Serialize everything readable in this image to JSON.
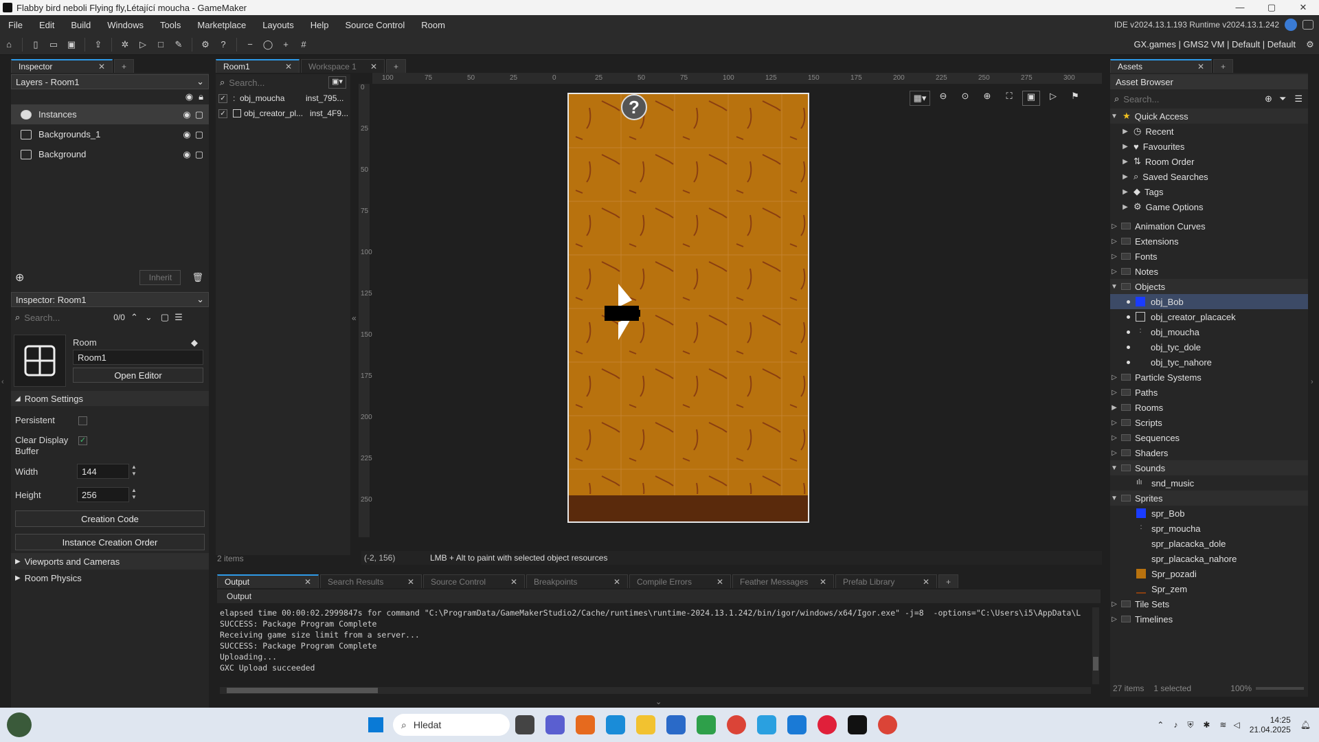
{
  "window": {
    "title": "Flabby bird neboli Flying fly,Létající moucha - GameMaker"
  },
  "menu": [
    "File",
    "Edit",
    "Build",
    "Windows",
    "Tools",
    "Marketplace",
    "Layouts",
    "Help",
    "Source Control",
    "Room"
  ],
  "version": "IDE v2024.13.1.193  Runtime v2024.13.1.242",
  "target": "GX.games  |  GMS2 VM  |  Default  |  Default",
  "left": {
    "tab": "Inspector",
    "layers_dd": "Layers - Room1",
    "layers": [
      {
        "name": "Instances"
      },
      {
        "name": "Backgrounds_1"
      },
      {
        "name": "Background"
      }
    ],
    "inherit": "Inherit",
    "inspector_dd": "Inspector: Room1",
    "search_placeholder": "Search...",
    "count": "0/0",
    "room_label": "Room",
    "room_name": "Room1",
    "open_editor": "Open Editor",
    "room_settings": "Room Settings",
    "persistent": "Persistent",
    "clear_display": "Clear Display",
    "clear_buffer": "Buffer",
    "width_label": "Width",
    "width": "144",
    "height_label": "Height",
    "height": "256",
    "creation_code": "Creation Code",
    "instance_order": "Instance Creation Order",
    "viewports": "Viewports and Cameras",
    "physics": "Room Physics"
  },
  "center": {
    "tabs": [
      "Room1",
      "Workspace 1"
    ],
    "search_placeholder": "Search...",
    "instances": [
      {
        "name": "obj_moucha",
        "id": "inst_795..."
      },
      {
        "name": "obj_creator_pl...",
        "id": "inst_4F9..."
      }
    ],
    "items": "2 items",
    "coords": "(-2, 156)",
    "hint": "LMB + Alt to paint with selected object resources",
    "ruler_top": [
      "100",
      "75",
      "50",
      "25",
      "0",
      "25",
      "50",
      "75",
      "100",
      "125",
      "150",
      "175",
      "200",
      "225",
      "250",
      "275",
      "300"
    ],
    "ruler_left": [
      "0",
      "25",
      "50",
      "75",
      "100",
      "125",
      "150",
      "175",
      "200",
      "225",
      "250"
    ]
  },
  "output": {
    "tabs": [
      "Output",
      "Search Results",
      "Source Control",
      "Breakpoints",
      "Compile Errors",
      "Feather Messages",
      "Prefab Library"
    ],
    "header": "Output",
    "lines": [
      "elapsed time 00:00:02.2999847s for command \"C:\\ProgramData/GameMakerStudio2/Cache/runtimes\\runtime-2024.13.1.242/bin/igor/windows/x64/Igor.exe\" -j=8  -options=\"C:\\Users\\i5\\AppData\\L",
      "SUCCESS: Package Program Complete",
      "Receiving game size limit from a server...",
      "SUCCESS: Package Program Complete",
      "Uploading...",
      "GXC Upload succeeded"
    ]
  },
  "assets": {
    "tab": "Assets",
    "title": "Asset Browser",
    "search_placeholder": "Search...",
    "quick_access": "Quick Access",
    "quick": [
      "Recent",
      "Favourites",
      "Room Order",
      "Saved Searches",
      "Tags",
      "Game Options"
    ],
    "groups_a": [
      "Animation Curves",
      "Extensions",
      "Fonts",
      "Notes"
    ],
    "objects": "Objects",
    "object_items": [
      "obj_Bob",
      "obj_creator_placacek",
      "obj_moucha",
      "obj_tyc_dole",
      "obj_tyc_nahore"
    ],
    "groups_b": [
      "Particle Systems",
      "Paths",
      "Rooms",
      "Scripts",
      "Sequences",
      "Shaders"
    ],
    "sounds": "Sounds",
    "sound_items": [
      "snd_music"
    ],
    "sprites": "Sprites",
    "sprite_items": [
      "spr_Bob",
      "spr_moucha",
      "spr_placacka_dole",
      "spr_placacka_nahore",
      "Spr_pozadi",
      "Spr_zem"
    ],
    "groups_c": [
      "Tile Sets",
      "Timelines"
    ],
    "footer_items": "27 items",
    "footer_selected": "1 selected",
    "zoom": "100%"
  },
  "taskbar": {
    "search": "Hledat",
    "time": "14:25",
    "date": "21.04.2025"
  },
  "colors": {
    "accent": "#2e9ae8",
    "room_bg": "#b8720e",
    "ground": "#5a2a0c",
    "selection": "#3c4a66"
  }
}
